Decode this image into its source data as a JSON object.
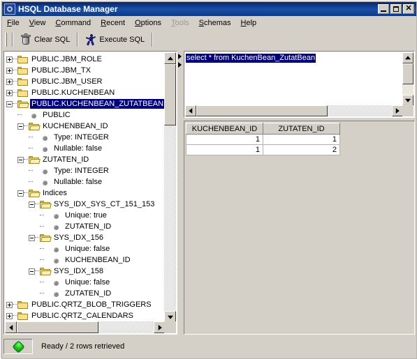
{
  "window": {
    "title": "HSQL Database Manager",
    "icon": "app-icon",
    "buttons": {
      "minimize": "_",
      "maximize": "□",
      "close": "✕"
    }
  },
  "menubar": {
    "items": [
      {
        "label": "File",
        "mnemonic": "F",
        "disabled": false
      },
      {
        "label": "View",
        "mnemonic": "V",
        "disabled": false
      },
      {
        "label": "Command",
        "mnemonic": "C",
        "disabled": false
      },
      {
        "label": "Recent",
        "mnemonic": "R",
        "disabled": false
      },
      {
        "label": "Options",
        "mnemonic": "O",
        "disabled": false
      },
      {
        "label": "Tools",
        "mnemonic": "T",
        "disabled": true
      },
      {
        "label": "Schemas",
        "mnemonic": "S",
        "disabled": false
      },
      {
        "label": "Help",
        "mnemonic": "H",
        "disabled": false
      }
    ]
  },
  "toolbar": {
    "clear_sql_label": "Clear SQL",
    "clear_sql_icon": "trash-icon",
    "execute_sql_label": "Execute SQL",
    "execute_sql_icon": "runner-icon"
  },
  "tree": {
    "nodes": [
      {
        "label": "PUBLIC.JBM_ROLE",
        "depth": 0,
        "kind": "folder",
        "state": "collapsed",
        "selected": false
      },
      {
        "label": "PUBLIC.JBM_TX",
        "depth": 0,
        "kind": "folder",
        "state": "collapsed",
        "selected": false
      },
      {
        "label": "PUBLIC.JBM_USER",
        "depth": 0,
        "kind": "folder",
        "state": "collapsed",
        "selected": false
      },
      {
        "label": "PUBLIC.KUCHENBEAN",
        "depth": 0,
        "kind": "folder",
        "state": "collapsed",
        "selected": false
      },
      {
        "label": "PUBLIC.KUCHENBEAN_ZUTATBEAN",
        "depth": 0,
        "kind": "folder-open",
        "state": "expanded",
        "selected": true
      },
      {
        "label": "PUBLIC",
        "depth": 1,
        "kind": "leaf",
        "state": "none",
        "selected": false
      },
      {
        "label": "KUCHENBEAN_ID",
        "depth": 1,
        "kind": "folder-open",
        "state": "expanded",
        "selected": false
      },
      {
        "label": "Type: INTEGER",
        "depth": 2,
        "kind": "leaf",
        "state": "none",
        "selected": false
      },
      {
        "label": "Nullable: false",
        "depth": 2,
        "kind": "leaf",
        "state": "none",
        "selected": false
      },
      {
        "label": "ZUTATEN_ID",
        "depth": 1,
        "kind": "folder-open",
        "state": "expanded",
        "selected": false
      },
      {
        "label": "Type: INTEGER",
        "depth": 2,
        "kind": "leaf",
        "state": "none",
        "selected": false
      },
      {
        "label": "Nullable: false",
        "depth": 2,
        "kind": "leaf",
        "state": "none",
        "selected": false
      },
      {
        "label": "Indices",
        "depth": 1,
        "kind": "folder-open",
        "state": "expanded",
        "selected": false
      },
      {
        "label": "SYS_IDX_SYS_CT_151_153",
        "depth": 2,
        "kind": "folder-open",
        "state": "expanded",
        "selected": false
      },
      {
        "label": "Unique: true",
        "depth": 3,
        "kind": "leaf",
        "state": "none",
        "selected": false
      },
      {
        "label": "ZUTATEN_ID",
        "depth": 3,
        "kind": "leaf",
        "state": "none",
        "selected": false
      },
      {
        "label": "SYS_IDX_156",
        "depth": 2,
        "kind": "folder-open",
        "state": "expanded",
        "selected": false
      },
      {
        "label": "Unique: false",
        "depth": 3,
        "kind": "leaf",
        "state": "none",
        "selected": false
      },
      {
        "label": "KUCHENBEAN_ID",
        "depth": 3,
        "kind": "leaf",
        "state": "none",
        "selected": false
      },
      {
        "label": "SYS_IDX_158",
        "depth": 2,
        "kind": "folder-open",
        "state": "expanded",
        "selected": false
      },
      {
        "label": "Unique: false",
        "depth": 3,
        "kind": "leaf",
        "state": "none",
        "selected": false
      },
      {
        "label": "ZUTATEN_ID",
        "depth": 3,
        "kind": "leaf",
        "state": "none",
        "selected": false
      },
      {
        "label": "PUBLIC.QRTZ_BLOB_TRIGGERS",
        "depth": 0,
        "kind": "folder",
        "state": "collapsed",
        "selected": false
      },
      {
        "label": "PUBLIC.QRTZ_CALENDARS",
        "depth": 0,
        "kind": "folder",
        "state": "collapsed",
        "selected": false
      }
    ]
  },
  "sql_editor": {
    "text": "select * from KuchenBean_ZutatBean",
    "selected": true,
    "selection_color": "#00007d"
  },
  "results": {
    "columns": [
      "KUCHENBEAN_ID",
      "ZUTATEN_ID"
    ],
    "rows": [
      [
        "1",
        "1"
      ],
      [
        "1",
        "2"
      ]
    ]
  },
  "statusbar": {
    "indicator": "green-led-icon",
    "indicator_color": "#17cc17",
    "text": "Ready / 2 rows retrieved"
  }
}
